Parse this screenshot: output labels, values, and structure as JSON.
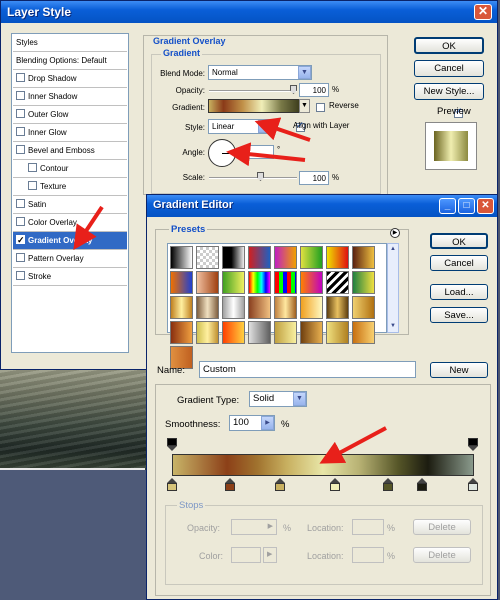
{
  "layer_style": {
    "title": "Layer Style",
    "close_label": "✕",
    "styles": [
      {
        "label": "Styles",
        "type": "header"
      },
      {
        "label": "Blending Options: Default",
        "type": "header"
      },
      {
        "label": "Drop Shadow",
        "checked": false
      },
      {
        "label": "Inner Shadow",
        "checked": false
      },
      {
        "label": "Outer Glow",
        "checked": false
      },
      {
        "label": "Inner Glow",
        "checked": false
      },
      {
        "label": "Bevel and Emboss",
        "checked": false
      },
      {
        "label": "Contour",
        "checked": false,
        "sub": true
      },
      {
        "label": "Texture",
        "checked": false,
        "sub": true
      },
      {
        "label": "Satin",
        "checked": false
      },
      {
        "label": "Color Overlay",
        "checked": false
      },
      {
        "label": "Gradient Overlay",
        "checked": true,
        "selected": true
      },
      {
        "label": "Pattern Overlay",
        "checked": false
      },
      {
        "label": "Stroke",
        "checked": false
      }
    ],
    "section_title": "Gradient Overlay",
    "group_title": "Gradient",
    "blend_mode_label": "Blend Mode:",
    "blend_mode_value": "Normal",
    "opacity_label": "Opacity:",
    "opacity_value": "100",
    "opacity_unit": "%",
    "gradient_label": "Gradient:",
    "reverse_label": "Reverse",
    "style_label": "Style:",
    "style_value": "Linear",
    "align_label": "Align with Layer",
    "angle_label": "Angle:",
    "angle_unit": "°",
    "scale_label": "Scale:",
    "scale_value": "100",
    "scale_unit": "%",
    "ok_label": "OK",
    "cancel_label": "Cancel",
    "new_style_label": "New Style...",
    "preview_label": "Preview"
  },
  "gradient_editor": {
    "title": "Gradient Editor",
    "minimize_label": "_",
    "maximize_label": "□",
    "close_label": "✕",
    "presets_label": "Presets",
    "ok_label": "OK",
    "cancel_label": "Cancel",
    "load_label": "Load...",
    "save_label": "Save...",
    "name_label": "Name:",
    "name_value": "Custom",
    "new_label": "New",
    "gradient_type_label": "Gradient Type:",
    "gradient_type_value": "Solid",
    "smoothness_label": "Smoothness:",
    "smoothness_value": "100",
    "smoothness_unit": "%",
    "stops_label": "Stops",
    "opacity_label": "Opacity:",
    "opacity_unit": "%",
    "color_label": "Color:",
    "location_label": "Location:",
    "location_unit": "%",
    "delete_label": "Delete"
  },
  "colors": {
    "accent": "#316ac5",
    "title_bar": "#0a5fd8",
    "annotation_red": "#e8201a",
    "section_blue": "#1450c8"
  }
}
